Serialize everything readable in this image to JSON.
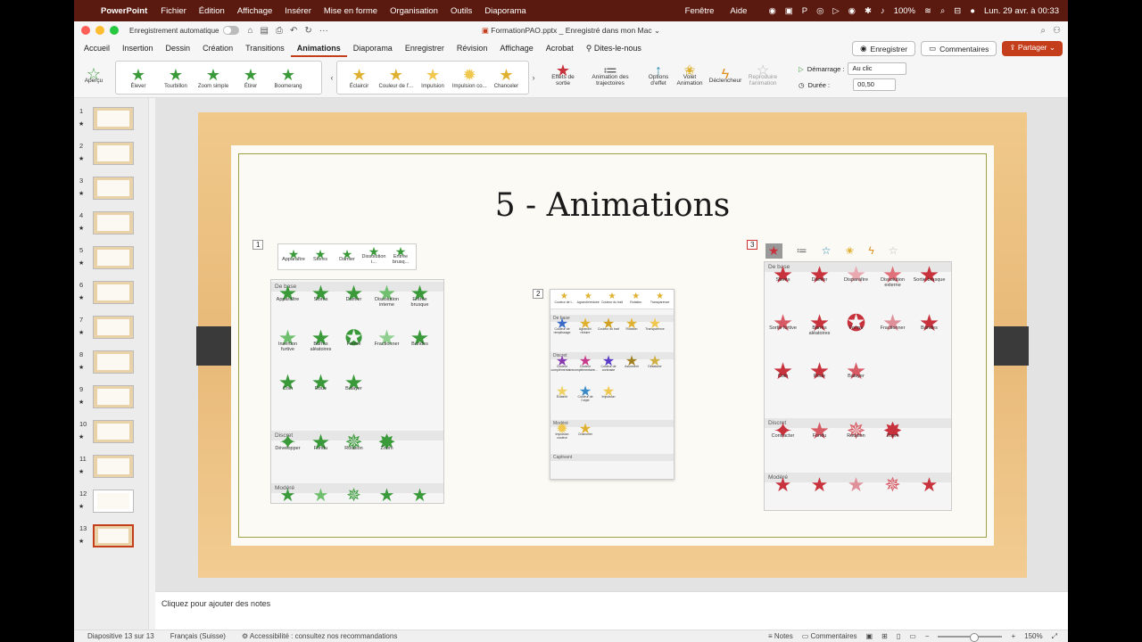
{
  "menubar": {
    "app": "PowerPoint",
    "items": [
      "Fichier",
      "Édition",
      "Affichage",
      "Insérer",
      "Mise en forme",
      "Organisation",
      "Outils",
      "Diaporama"
    ],
    "right_items": [
      "Fenêtre",
      "Aide"
    ],
    "battery": "100%",
    "clock": "Lun. 29 avr. à 00:33"
  },
  "titlebar": {
    "autosave_label": "Enregistrement automatique",
    "filename": "FormationPAO.pptx",
    "saved_status": "_ Enregistré dans mon Mac"
  },
  "tabs": [
    "Accueil",
    "Insertion",
    "Dessin",
    "Création",
    "Transitions",
    "Animations",
    "Diaporama",
    "Enregistrer",
    "Révision",
    "Affichage",
    "Acrobat"
  ],
  "active_tab": "Animations",
  "tell_me": "Dites-le-nous",
  "tab_actions": {
    "record": "Enregistrer",
    "comments": "Commentaires",
    "share": "Partager"
  },
  "ribbon": {
    "preview": "Aperçu",
    "entrance_effects": [
      "Élever",
      "Tourbillon",
      "Zoom simple",
      "Étirer",
      "Boomerang"
    ],
    "emphasis_effects": [
      "Éclaircir",
      "Couleur de l'...",
      "Impulsion",
      "Impulsion co...",
      "Chanceler"
    ],
    "exit_effects": "Effets de sortie",
    "motion_paths": "Animation des trajectoires",
    "effect_options": "Options d'effet",
    "animation_pane": "Volet Animation",
    "trigger": "Déclencheur",
    "painter": "Reproduire l'animation",
    "start_label": "Démarrage :",
    "start_value": "Au clic",
    "duration_label": "Durée :",
    "duration_value": "00,50"
  },
  "thumbnails": [
    "1",
    "2",
    "3",
    "4",
    "5",
    "6",
    "7",
    "8",
    "9",
    "10",
    "11",
    "12",
    "13"
  ],
  "selected_slide": "13",
  "slide": {
    "title": "5 - Animations",
    "panel1": {
      "tag": "1",
      "top_row": [
        "Apparaître",
        "Stores",
        "Damier",
        "Dissolution i...",
        "Entrée brusq..."
      ],
      "sections": [
        {
          "name": "De base",
          "items": [
            "Apparaître",
            "Stores",
            "Damier",
            "Dissolution interne",
            "Entrée brusque",
            "Insertion furtive",
            "Barres aléatoires",
            "Forme",
            "Fractionner",
            "Bandes",
            "Coin",
            "Roue",
            "Balayer"
          ]
        },
        {
          "name": "Discret",
          "items": [
            "Développer",
            "Fondu",
            "Rotation",
            "Zoom"
          ]
        },
        {
          "name": "Modéré",
          "items": [
            "",
            "",
            "",
            "",
            ""
          ]
        }
      ]
    },
    "panel2": {
      "tag": "2",
      "top_row": [
        "Couleur de l...",
        "Agrandir/réduire",
        "Couleur du trait",
        "Rotation",
        "Transparence"
      ],
      "sections": [
        {
          "name": "De base",
          "items": [
            "Couleur de remplissage",
            "Agrandir/ réduire",
            "Couleur du trait",
            "Rotation",
            "Transparence"
          ]
        },
        {
          "name": "Discret",
          "items": [
            "Couleur complémentaire",
            "Couleur complémentaire...",
            "Couleur de contraste",
            "Assombrir",
            "Désaturer",
            "Éclaircir",
            "Couleur de l'objet",
            "Impulsion"
          ]
        },
        {
          "name": "Modéré",
          "items": [
            "Impulsion couleur",
            "Chanceler"
          ]
        },
        {
          "name": "Captivant",
          "items": []
        }
      ]
    },
    "panel3": {
      "tag": "3",
      "sections": [
        {
          "name": "De base",
          "items": [
            "Stores",
            "Damier",
            "Disparaître",
            "Dissolution externe",
            "Sortie brusque",
            "Sortie furtive",
            "Barres aléatoires",
            "Forme",
            "Fractionner",
            "Bandes",
            "Coin",
            "Roue",
            "Balayer"
          ]
        },
        {
          "name": "Discret",
          "items": [
            "Contracter",
            "Fondu",
            "Rotation",
            "Zoom"
          ]
        },
        {
          "name": "Modéré",
          "items": [
            "",
            "",
            "",
            "",
            ""
          ]
        }
      ]
    }
  },
  "notes_placeholder": "Cliquez pour ajouter des notes",
  "status": {
    "slide_count": "Diapositive 13 sur 13",
    "language": "Français (Suisse)",
    "accessibility": "Accessibilité : consultez nos recommandations",
    "notes": "Notes",
    "comments": "Commentaires",
    "zoom": "150%"
  },
  "colors": {
    "accent": "#c43e1c",
    "entrance": "#3a9a3a",
    "emphasis": "#e0b030",
    "exit": "#c8323c"
  }
}
